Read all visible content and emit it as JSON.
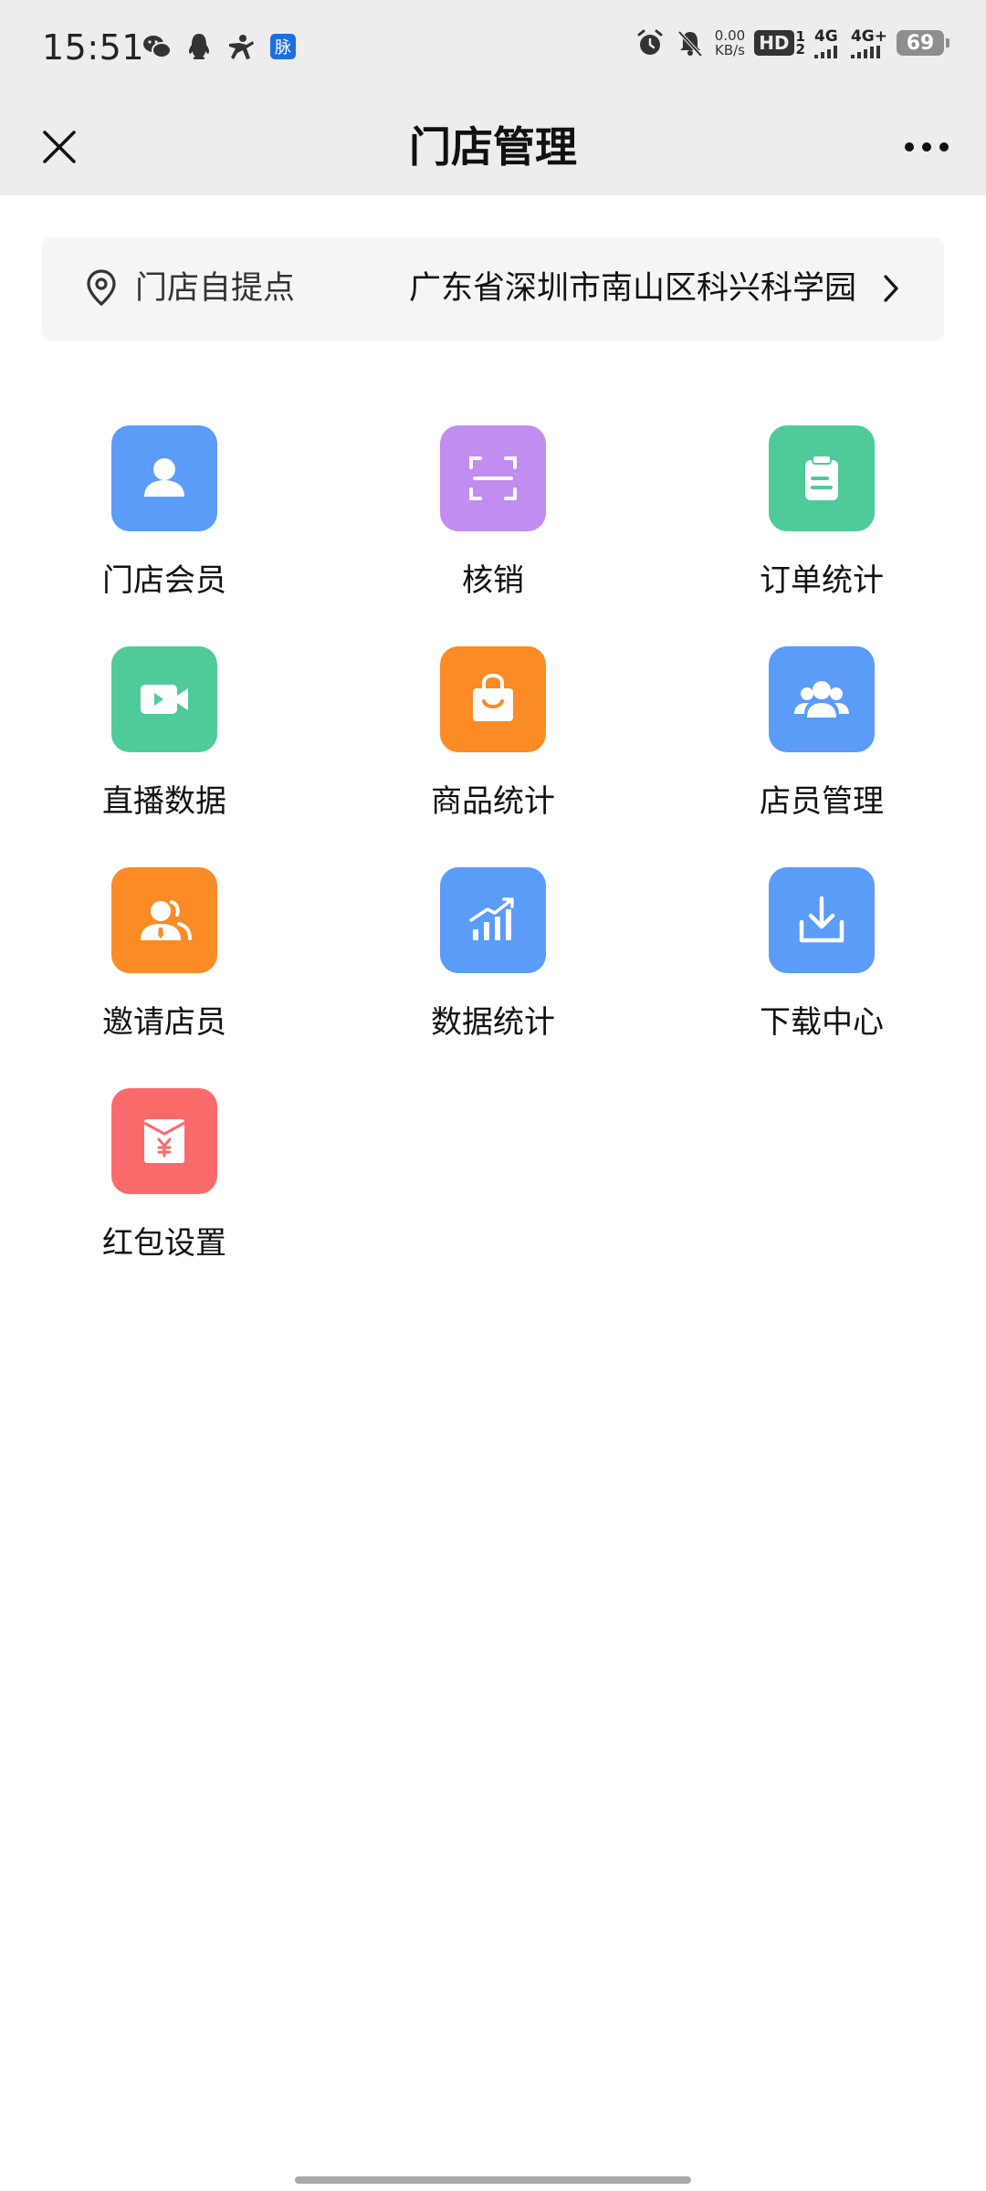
{
  "status_bar": {
    "time": "15:51",
    "net_speed_value": "0.00",
    "net_speed_unit": "KB/s",
    "hd_label": "HD",
    "sim1_label": "1",
    "sim2_label": "2",
    "signal1_label": "4G",
    "signal2_label": "4G+",
    "battery": "69",
    "icons": [
      "wechat-icon",
      "qq-icon",
      "app-icon",
      "mai-icon",
      "alarm-icon",
      "mute-icon"
    ]
  },
  "header": {
    "title": "门店管理"
  },
  "location": {
    "label": "门店自提点",
    "address": "广东省深圳市南山区科兴科学园"
  },
  "grid": {
    "items": [
      {
        "label": "门店会员",
        "color": "#5b9cf8",
        "icon": "member-icon"
      },
      {
        "label": "核销",
        "color": "#c18df0",
        "icon": "scan-icon"
      },
      {
        "label": "订单统计",
        "color": "#4fcb9a",
        "icon": "clipboard-icon"
      },
      {
        "label": "直播数据",
        "color": "#4fcb9a",
        "icon": "video-icon"
      },
      {
        "label": "商品统计",
        "color": "#fb8b24",
        "icon": "shopping-bag-icon"
      },
      {
        "label": "店员管理",
        "color": "#5b9cf8",
        "icon": "staff-icon"
      },
      {
        "label": "邀请店员",
        "color": "#fb8b24",
        "icon": "invite-icon"
      },
      {
        "label": "数据统计",
        "color": "#5b9cf8",
        "icon": "chart-icon"
      },
      {
        "label": "下载中心",
        "color": "#5b9cf8",
        "icon": "download-icon"
      },
      {
        "label": "红包设置",
        "color": "#fb6a6a",
        "icon": "red-packet-icon"
      }
    ]
  }
}
